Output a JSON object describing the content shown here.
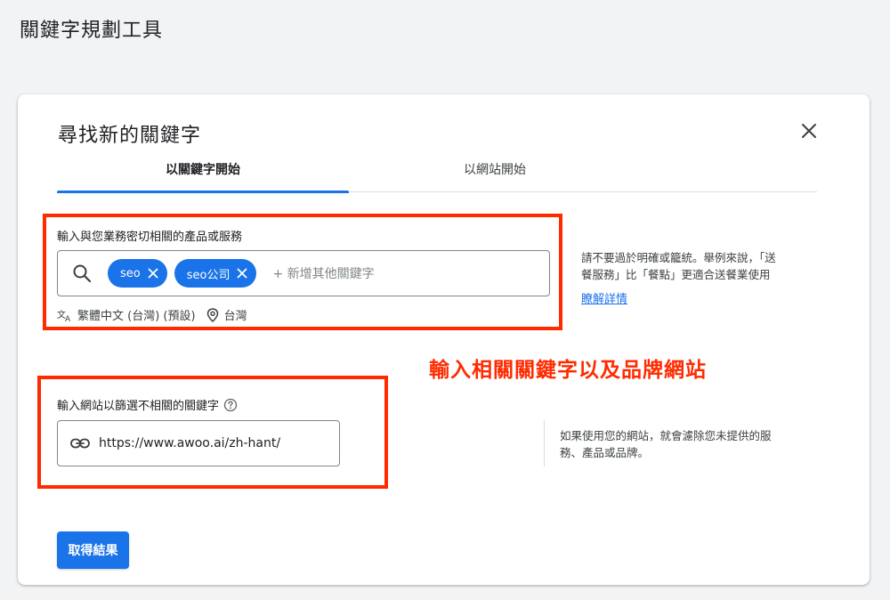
{
  "page": {
    "title": "關鍵字規劃工具"
  },
  "dialog": {
    "title": "尋找新的關鍵字",
    "tabs": [
      {
        "label": "以關鍵字開始",
        "active": true
      },
      {
        "label": "以網站開始",
        "active": false
      }
    ]
  },
  "keywords_section": {
    "label": "輸入與您業務密切相關的產品或服務",
    "chips": [
      "seo",
      "seo公司"
    ],
    "placeholder": "+ 新增其他關鍵字",
    "language": "繁體中文 (台灣) (預設)",
    "location": "台灣",
    "help_line1": "請不要過於明確或籠統。舉例來說，「送",
    "help_line2": "餐服務」比「餐點」更適合送餐業使用",
    "learn_more": "瞭解詳情"
  },
  "annotation": {
    "text": "輸入相關關鍵字以及品牌網站"
  },
  "website_section": {
    "label": "輸入網站以篩選不相關的關鍵字",
    "url_value": "https://www.awoo.ai/zh-hant/",
    "help_line1": "如果使用您的網站，就會濾除您未提供的服",
    "help_line2": "務、產品或品牌。"
  },
  "submit": {
    "label": "取得結果"
  },
  "colors": {
    "accent": "#1a73e8",
    "annotation_red": "#ff2a00",
    "background": "#f1f3f4"
  }
}
